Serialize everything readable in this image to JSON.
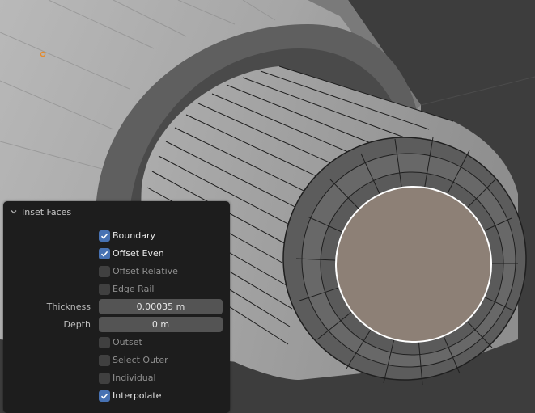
{
  "panel": {
    "title": "Inset Faces",
    "options_top": [
      {
        "label": "Boundary",
        "checked": true
      },
      {
        "label": "Offset Even",
        "checked": true
      },
      {
        "label": "Offset Relative",
        "checked": false
      },
      {
        "label": "Edge Rail",
        "checked": false
      }
    ],
    "thickness": {
      "label": "Thickness",
      "value": "0.00035 m"
    },
    "depth": {
      "label": "Depth",
      "value": "0 m"
    },
    "options_bottom": [
      {
        "label": "Outset",
        "checked": false
      },
      {
        "label": "Select Outer",
        "checked": false
      },
      {
        "label": "Individual",
        "checked": false
      },
      {
        "label": "Interpolate",
        "checked": true
      }
    ]
  },
  "colors": {
    "viewport_background": "#3d3d3d",
    "panel_background": "#1d1d1d",
    "checkbox_checked": "#4772b3",
    "selected_face": "#8d8076",
    "origin_point": "#e58a2b"
  }
}
